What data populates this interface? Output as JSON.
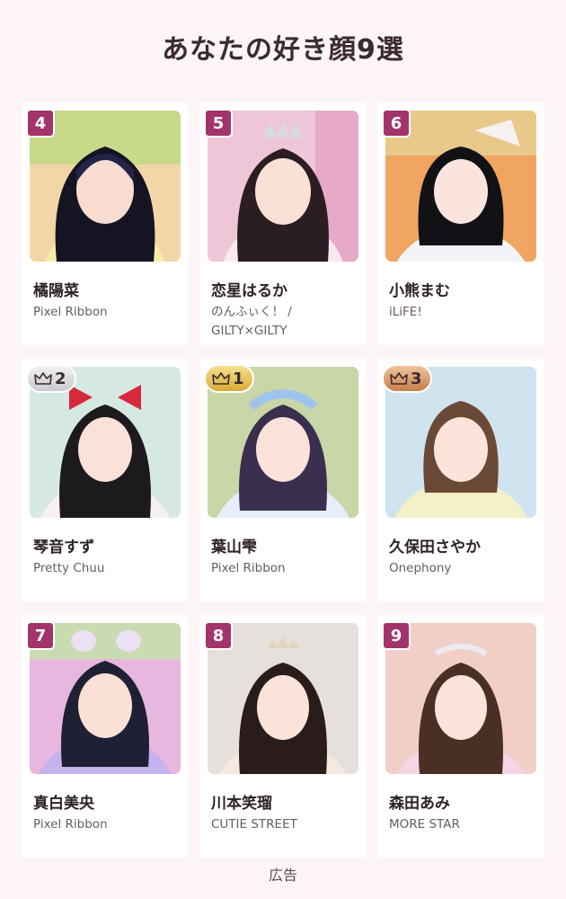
{
  "title": "あなたの好き顔9選",
  "ad_label": "広告",
  "cards": [
    {
      "badge": "4",
      "badge_type": "number",
      "name": "橘陽菜",
      "group": "Pixel Ribbon"
    },
    {
      "badge": "5",
      "badge_type": "number",
      "name": "恋星はるか",
      "group": "のんふぃく！ / GILTY×GILTY"
    },
    {
      "badge": "6",
      "badge_type": "number",
      "name": "小熊まむ",
      "group": "iLiFE!"
    },
    {
      "badge": "2",
      "badge_type": "silver",
      "name": "琴音すず",
      "group": "Pretty Chuu"
    },
    {
      "badge": "1",
      "badge_type": "gold",
      "name": "葉山雫",
      "group": "Pixel Ribbon"
    },
    {
      "badge": "3",
      "badge_type": "bronze",
      "name": "久保田さやか",
      "group": "Onephony"
    },
    {
      "badge": "7",
      "badge_type": "number",
      "name": "真白美央",
      "group": "Pixel Ribbon"
    },
    {
      "badge": "8",
      "badge_type": "number",
      "name": "川本笑瑠",
      "group": "CUTIE STREET"
    },
    {
      "badge": "9",
      "badge_type": "number",
      "name": "森田あみ",
      "group": "MORE STAR"
    }
  ],
  "colors": {
    "badge_number": "#a2346b",
    "gold": "#e0b548",
    "silver": "#d6d6dc",
    "bronze": "#d4935e",
    "page_background": "#fdf5f7"
  }
}
